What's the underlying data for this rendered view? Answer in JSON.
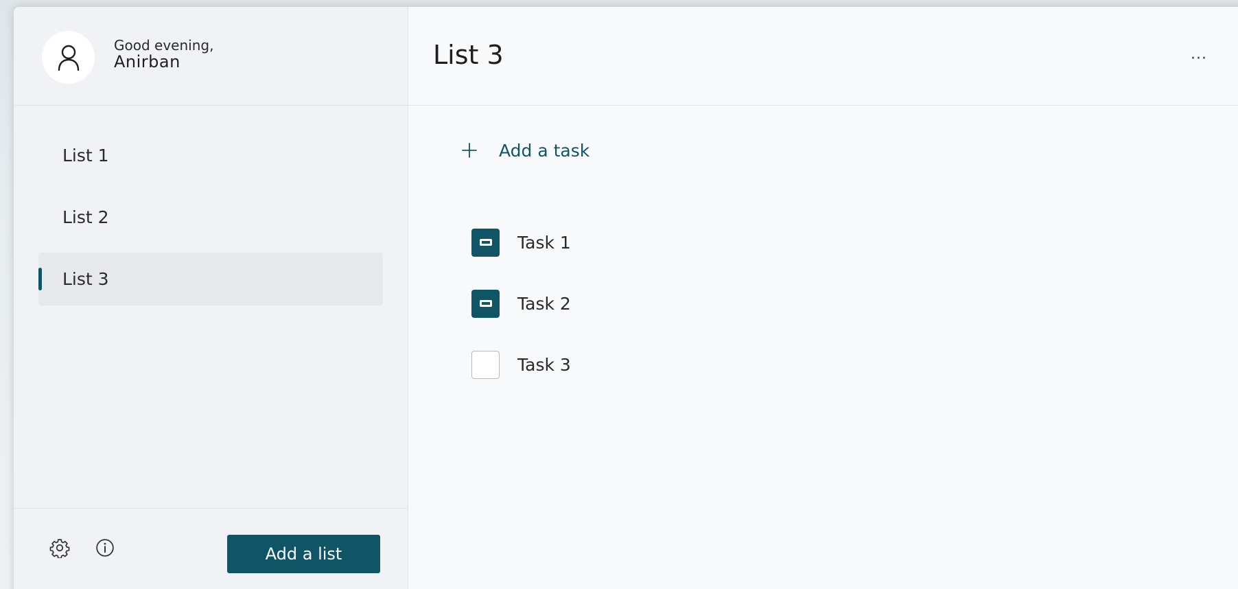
{
  "header": {
    "greeting": "Good evening,",
    "username": "Anirban"
  },
  "sidebar": {
    "items": [
      {
        "label": "List 1",
        "active": false
      },
      {
        "label": "List 2",
        "active": false
      },
      {
        "label": "List 3",
        "active": true
      }
    ],
    "footer": {
      "settings_icon": "gear-icon",
      "info_icon": "info-icon",
      "add_list_label": "Add a list"
    }
  },
  "main": {
    "title": "List 3",
    "more_icon": "···",
    "add_task_label": "Add a task",
    "tasks": [
      {
        "label": "Task 1",
        "checked": true
      },
      {
        "label": "Task 2",
        "checked": true
      },
      {
        "label": "Task 3",
        "checked": false
      }
    ]
  },
  "colors": {
    "accent": "#0f5566",
    "sidebar_bg": "#f1f2f5",
    "main_bg": "#f8f9fb",
    "active_item_bg": "#e6e8ec"
  }
}
